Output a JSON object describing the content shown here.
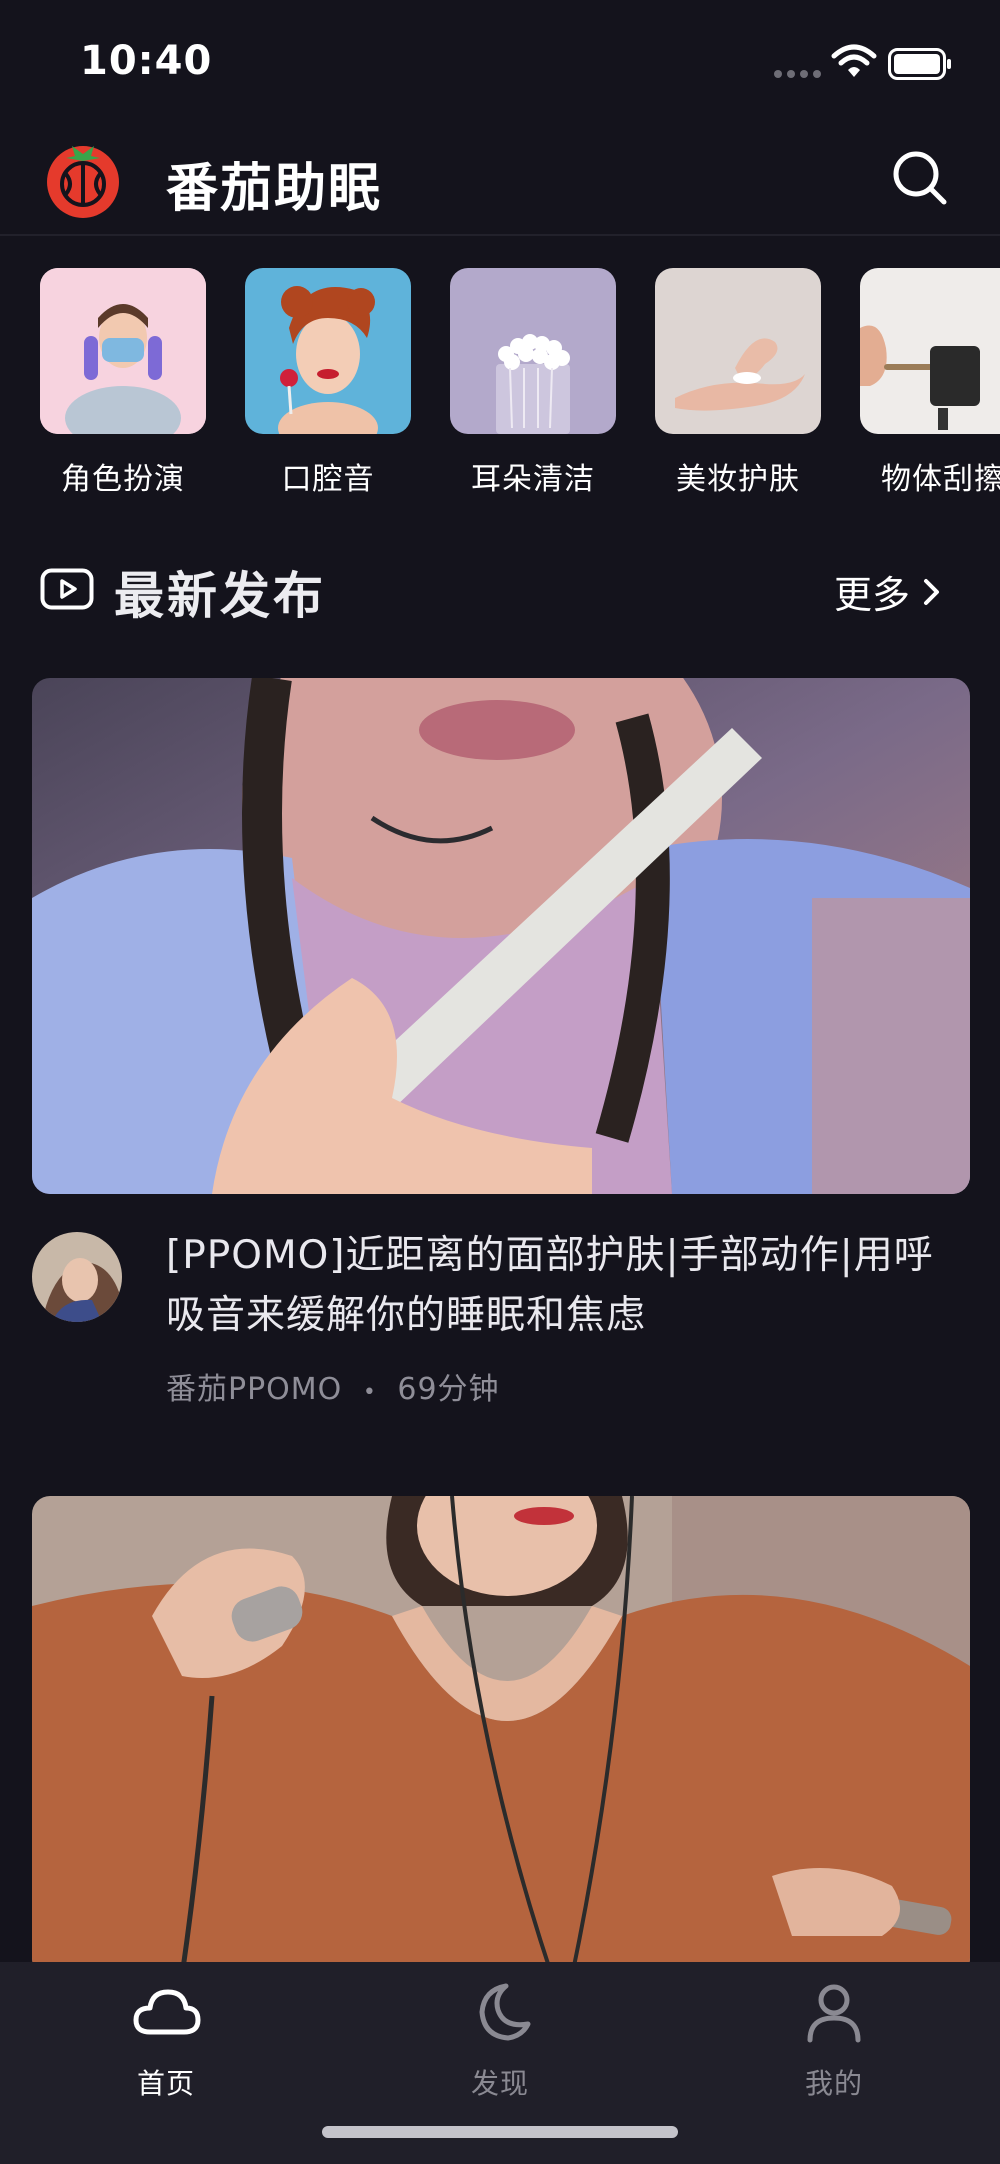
{
  "status_bar": {
    "time": "10:40"
  },
  "header": {
    "app_title": "番茄助眠",
    "logo_icon": "tomato-logo-icon",
    "search_icon": "search-icon"
  },
  "categories": [
    {
      "label": "角色扮演"
    },
    {
      "label": "口腔音"
    },
    {
      "label": "耳朵清洁"
    },
    {
      "label": "美妆护肤"
    },
    {
      "label": "物体刮擦"
    }
  ],
  "section": {
    "title": "最新发布",
    "more_label": "更多",
    "icon": "video-play-icon"
  },
  "feed": [
    {
      "title": "[PPOMO]近距离的面部护肤|手部动作|用呼吸音来缓解你的睡眠和焦虑",
      "author": "番茄PPOMO",
      "duration": "69分钟",
      "separator": "•"
    }
  ],
  "tab_bar": {
    "tabs": [
      {
        "label": "首页",
        "icon": "cloud-icon",
        "active": true
      },
      {
        "label": "发现",
        "icon": "moon-icon",
        "active": false
      },
      {
        "label": "我的",
        "icon": "user-icon",
        "active": false
      }
    ]
  },
  "colors": {
    "background": "#14131c",
    "tab_bar": "#201f29",
    "active_tab": "#ffffff",
    "inactive_tab": "#8a8992",
    "logo_red": "#e53a2c"
  }
}
